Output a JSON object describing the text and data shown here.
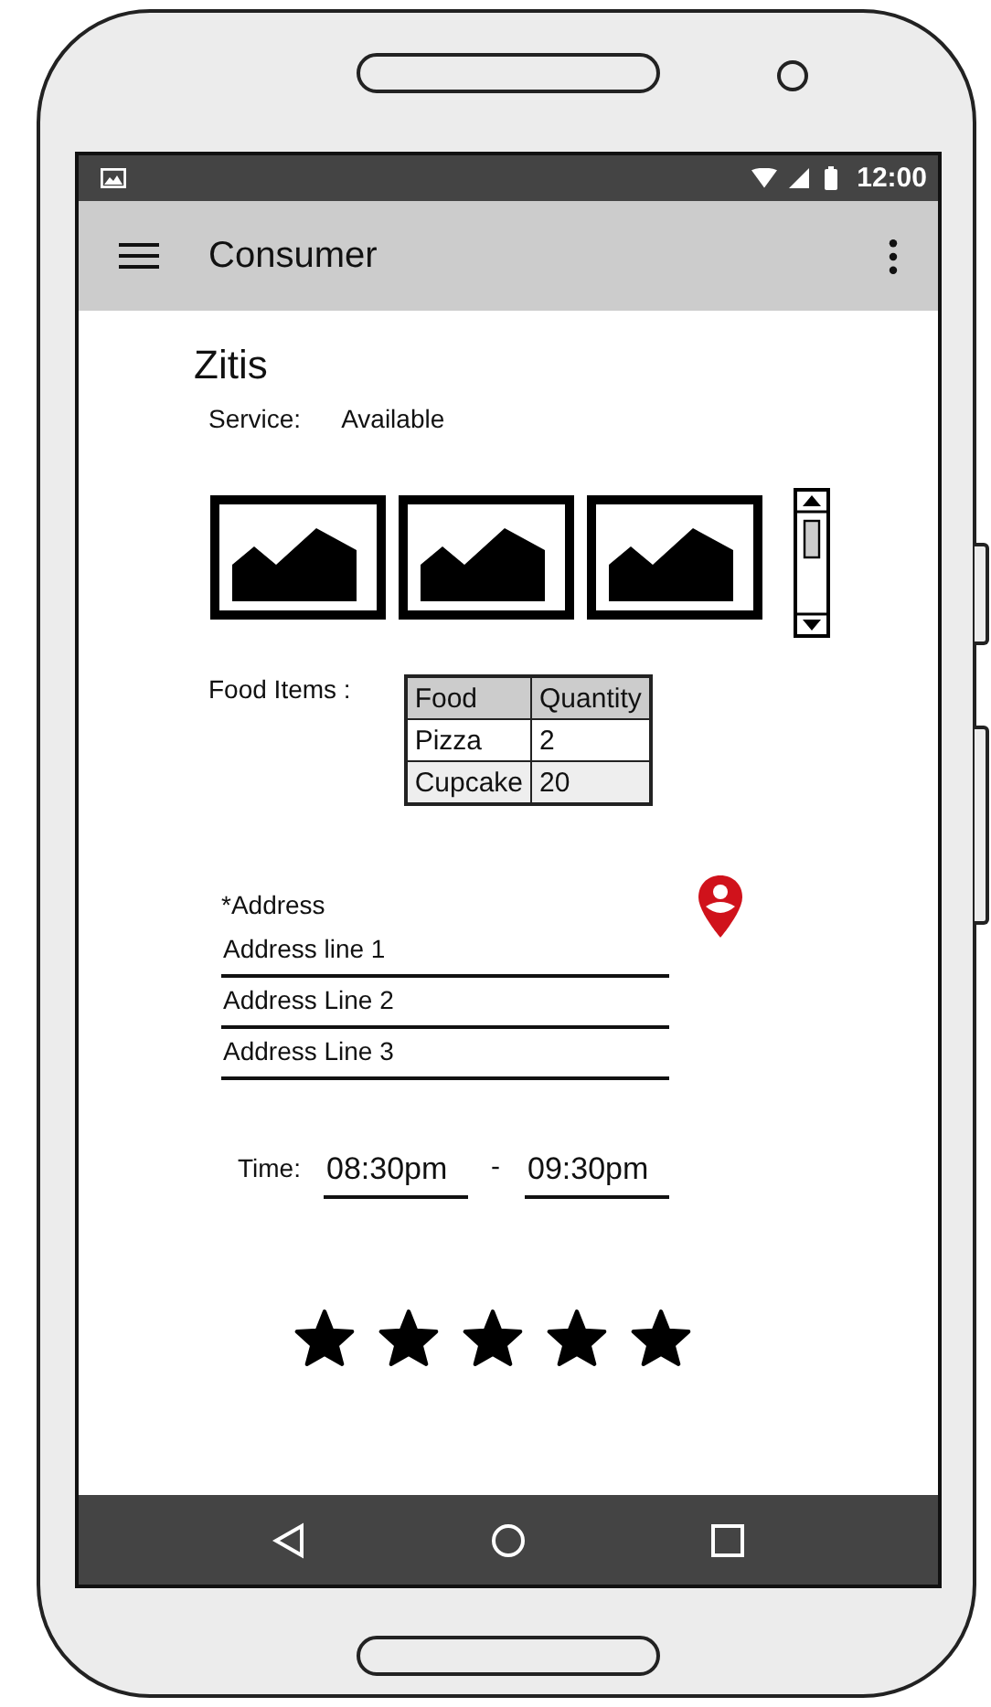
{
  "status_bar": {
    "time": "12:00"
  },
  "app_bar": {
    "title": "Consumer"
  },
  "restaurant": {
    "name": "Zitis",
    "service_label": "Service:",
    "service_value": "Available"
  },
  "food": {
    "label": "Food Items :",
    "columns": [
      "Food",
      "Quantity"
    ],
    "rows": [
      [
        "Pizza",
        "2"
      ],
      [
        "Cupcake",
        "20"
      ]
    ]
  },
  "address": {
    "label": "*Address",
    "fields": [
      {
        "value": "Address line 1"
      },
      {
        "value": "Address Line 2"
      },
      {
        "value": "Address Line 3"
      }
    ]
  },
  "time": {
    "label": "Time:",
    "from": "08:30pm",
    "separator": "-",
    "to": "09:30pm"
  },
  "rating": {
    "stars": 5
  }
}
